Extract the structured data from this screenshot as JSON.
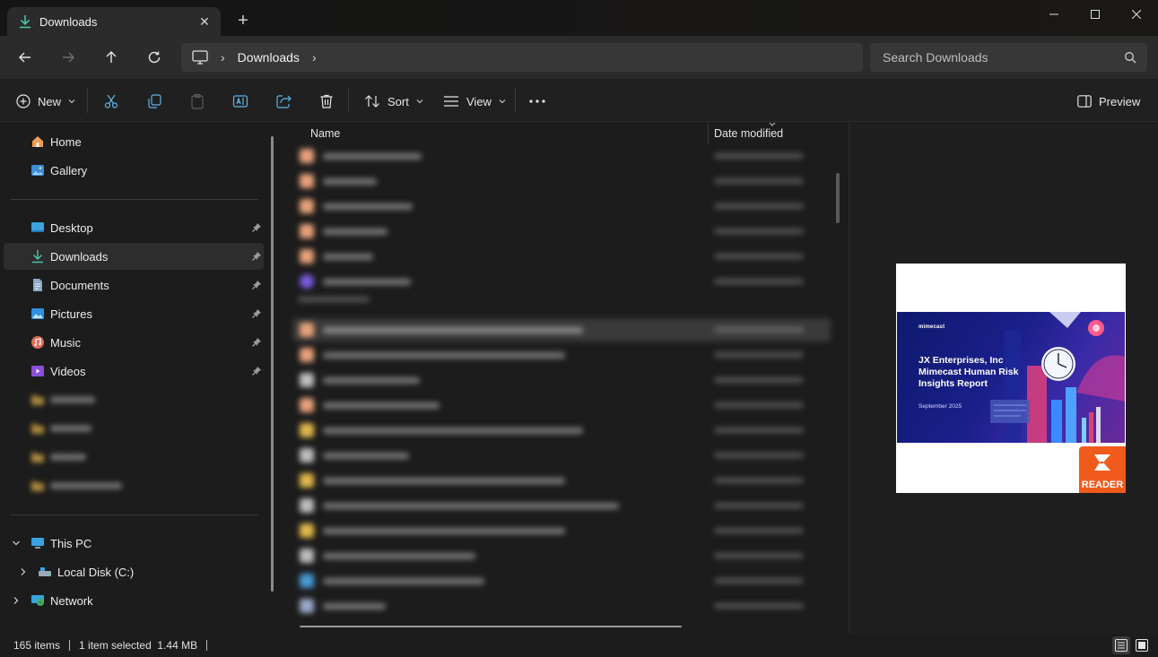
{
  "window": {
    "tab_title": "Downloads",
    "accent": "#4cc2a6"
  },
  "address": {
    "crumbs": [
      "Downloads"
    ],
    "search_placeholder": "Search Downloads"
  },
  "commandbar": {
    "new_label": "New",
    "sort_label": "Sort",
    "view_label": "View",
    "preview_label": "Preview"
  },
  "sidebar": {
    "top": [
      {
        "label": "Home",
        "icon": "home-icon"
      },
      {
        "label": "Gallery",
        "icon": "gallery-icon"
      }
    ],
    "quick": [
      {
        "label": "Desktop",
        "icon": "desktop-folder-icon"
      },
      {
        "label": "Downloads",
        "icon": "downloads-folder-icon",
        "selected": true
      },
      {
        "label": "Documents",
        "icon": "documents-folder-icon"
      },
      {
        "label": "Pictures",
        "icon": "pictures-folder-icon"
      },
      {
        "label": "Music",
        "icon": "music-folder-icon"
      },
      {
        "label": "Videos",
        "icon": "videos-folder-icon"
      }
    ],
    "tree": [
      {
        "label": "This PC",
        "icon": "this-pc-icon",
        "expanded": true
      },
      {
        "label": "Local Disk (C:)",
        "icon": "drive-icon"
      },
      {
        "label": "Network",
        "icon": "network-icon"
      }
    ]
  },
  "filelist": {
    "col_name": "Name",
    "col_date": "Date modified"
  },
  "preview": {
    "doc_brand": "mimecast",
    "doc_title": "JX Enterprises, Inc Mimecast Human Risk Insights Report",
    "doc_subtitle": "September 2025",
    "badge_text": "READER"
  },
  "status": {
    "items_count": "165 items",
    "selection": "1 item selected  1.44 MB"
  }
}
